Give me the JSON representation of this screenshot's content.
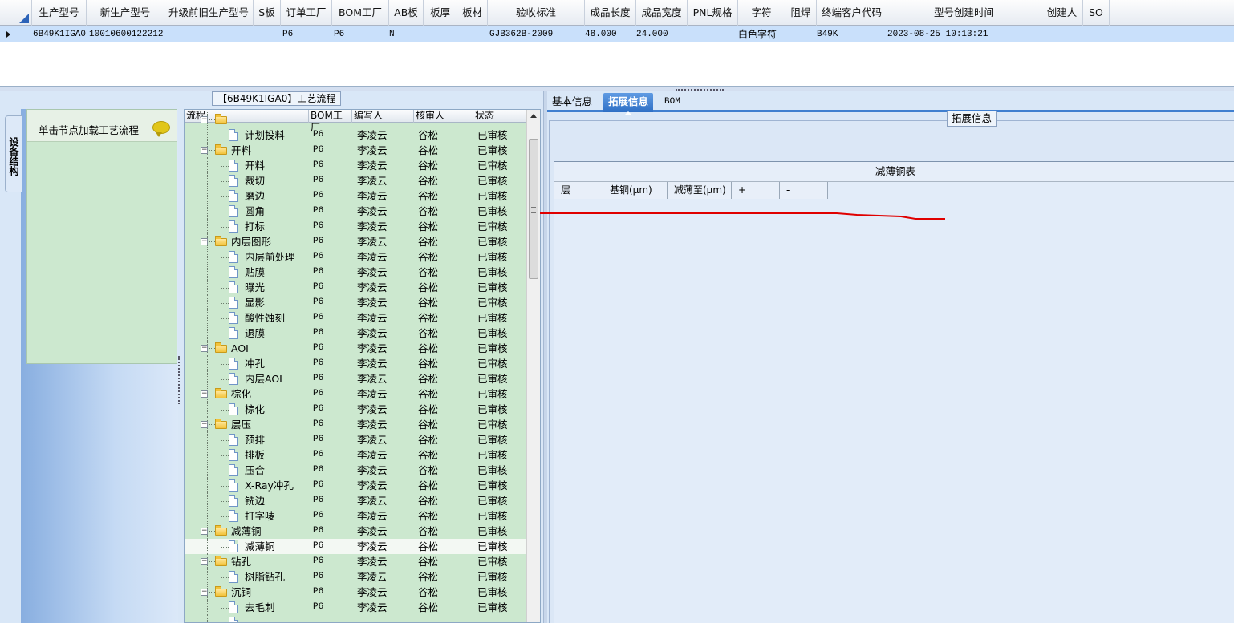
{
  "top_grid": {
    "columns": [
      "生产型号",
      "新生产型号",
      "升级前旧生产型号",
      "S板",
      "订单工厂",
      "BOM工厂",
      "AB板",
      "板厚",
      "板材",
      "验收标准",
      "成品长度",
      "成品宽度",
      "PNL规格",
      "字符",
      "阻焊",
      "终端客户代码",
      "型号创建时间",
      "创建人",
      "SO"
    ],
    "row": [
      "6B49K1IGA0",
      "10010600122212",
      "",
      "",
      "P6",
      "P6",
      "N",
      "",
      "",
      "GJB362B-2009",
      "48.000",
      "24.000",
      "",
      "白色字符",
      "",
      "B49K",
      "2023-08-25 10:13:21",
      "",
      ""
    ]
  },
  "left": {
    "title": "【6B49K1IGA0】工艺流程",
    "vertical_tab": "设备结构",
    "nav_hint": "单击节点加载工艺流程"
  },
  "tree": {
    "headers": [
      "流程",
      "BOM工厂",
      "编写人",
      "核审人",
      "状态"
    ],
    "rows": [
      {
        "name": "",
        "bom": "",
        "writer": "",
        "reviewer": "",
        "status": "",
        "level": 0
      },
      {
        "name": "计划投料",
        "bom": "P6",
        "writer": "李凌云",
        "reviewer": "谷松",
        "status": "已审核",
        "level": 1
      },
      {
        "name": "开料",
        "bom": "P6",
        "writer": "李凌云",
        "reviewer": "谷松",
        "status": "已审核",
        "level": 0
      },
      {
        "name": "开料",
        "bom": "P6",
        "writer": "李凌云",
        "reviewer": "谷松",
        "status": "已审核",
        "level": 1
      },
      {
        "name": "裁切",
        "bom": "P6",
        "writer": "李凌云",
        "reviewer": "谷松",
        "status": "已审核",
        "level": 1
      },
      {
        "name": "磨边",
        "bom": "P6",
        "writer": "李凌云",
        "reviewer": "谷松",
        "status": "已审核",
        "level": 1
      },
      {
        "name": "圆角",
        "bom": "P6",
        "writer": "李凌云",
        "reviewer": "谷松",
        "status": "已审核",
        "level": 1
      },
      {
        "name": "打标",
        "bom": "P6",
        "writer": "李凌云",
        "reviewer": "谷松",
        "status": "已审核",
        "level": 1
      },
      {
        "name": "内层图形",
        "bom": "P6",
        "writer": "李凌云",
        "reviewer": "谷松",
        "status": "已审核",
        "level": 0
      },
      {
        "name": "内层前处理",
        "bom": "P6",
        "writer": "李凌云",
        "reviewer": "谷松",
        "status": "已审核",
        "level": 1
      },
      {
        "name": "贴膜",
        "bom": "P6",
        "writer": "李凌云",
        "reviewer": "谷松",
        "status": "已审核",
        "level": 1
      },
      {
        "name": "曝光",
        "bom": "P6",
        "writer": "李凌云",
        "reviewer": "谷松",
        "status": "已审核",
        "level": 1
      },
      {
        "name": "显影",
        "bom": "P6",
        "writer": "李凌云",
        "reviewer": "谷松",
        "status": "已审核",
        "level": 1
      },
      {
        "name": "酸性蚀刻",
        "bom": "P6",
        "writer": "李凌云",
        "reviewer": "谷松",
        "status": "已审核",
        "level": 1
      },
      {
        "name": "退膜",
        "bom": "P6",
        "writer": "李凌云",
        "reviewer": "谷松",
        "status": "已审核",
        "level": 1
      },
      {
        "name": "AOI",
        "bom": "P6",
        "writer": "李凌云",
        "reviewer": "谷松",
        "status": "已审核",
        "level": 0
      },
      {
        "name": "冲孔",
        "bom": "P6",
        "writer": "李凌云",
        "reviewer": "谷松",
        "status": "已审核",
        "level": 1
      },
      {
        "name": "内层AOI",
        "bom": "P6",
        "writer": "李凌云",
        "reviewer": "谷松",
        "status": "已审核",
        "level": 1
      },
      {
        "name": "棕化",
        "bom": "P6",
        "writer": "李凌云",
        "reviewer": "谷松",
        "status": "已审核",
        "level": 0
      },
      {
        "name": "棕化",
        "bom": "P6",
        "writer": "李凌云",
        "reviewer": "谷松",
        "status": "已审核",
        "level": 1
      },
      {
        "name": "层压",
        "bom": "P6",
        "writer": "李凌云",
        "reviewer": "谷松",
        "status": "已审核",
        "level": 0
      },
      {
        "name": "预排",
        "bom": "P6",
        "writer": "李凌云",
        "reviewer": "谷松",
        "status": "已审核",
        "level": 1
      },
      {
        "name": "排板",
        "bom": "P6",
        "writer": "李凌云",
        "reviewer": "谷松",
        "status": "已审核",
        "level": 1
      },
      {
        "name": "压合",
        "bom": "P6",
        "writer": "李凌云",
        "reviewer": "谷松",
        "status": "已审核",
        "level": 1
      },
      {
        "name": "X-Ray冲孔",
        "bom": "P6",
        "writer": "李凌云",
        "reviewer": "谷松",
        "status": "已审核",
        "level": 1
      },
      {
        "name": "铣边",
        "bom": "P6",
        "writer": "李凌云",
        "reviewer": "谷松",
        "status": "已审核",
        "level": 1
      },
      {
        "name": "打字唛",
        "bom": "P6",
        "writer": "李凌云",
        "reviewer": "谷松",
        "status": "已审核",
        "level": 1
      },
      {
        "name": "减薄铜",
        "bom": "P6",
        "writer": "李凌云",
        "reviewer": "谷松",
        "status": "已审核",
        "level": 0
      },
      {
        "name": "减薄铜",
        "bom": "P6",
        "writer": "李凌云",
        "reviewer": "谷松",
        "status": "已审核",
        "level": 1,
        "selected": true
      },
      {
        "name": "钻孔",
        "bom": "P6",
        "writer": "李凌云",
        "reviewer": "谷松",
        "status": "已审核",
        "level": 0
      },
      {
        "name": "树脂钻孔",
        "bom": "P6",
        "writer": "李凌云",
        "reviewer": "谷松",
        "status": "已审核",
        "level": 1
      },
      {
        "name": "沉铜",
        "bom": "P6",
        "writer": "李凌云",
        "reviewer": "谷松",
        "status": "已审核",
        "level": 0
      },
      {
        "name": "去毛刺",
        "bom": "P6",
        "writer": "李凌云",
        "reviewer": "谷松",
        "status": "已审核",
        "level": 1
      },
      {
        "name": "",
        "bom": "",
        "writer": "",
        "reviewer": "",
        "status": "",
        "level": 1
      }
    ]
  },
  "right": {
    "tabs": [
      "基本信息",
      "拓展信息",
      "BOM"
    ],
    "active_tab": 1,
    "group_title": "拓展信息",
    "table_title": "减薄铜表",
    "table_columns": [
      "层",
      "基铜(μm)",
      "减薄至(μm)",
      "+",
      "-"
    ]
  },
  "colors": {
    "tree_bg": "#cce8cf",
    "selected_row": "#c9e0fb",
    "tab_active": "#2e6fc5",
    "annotation": "#e00000"
  }
}
